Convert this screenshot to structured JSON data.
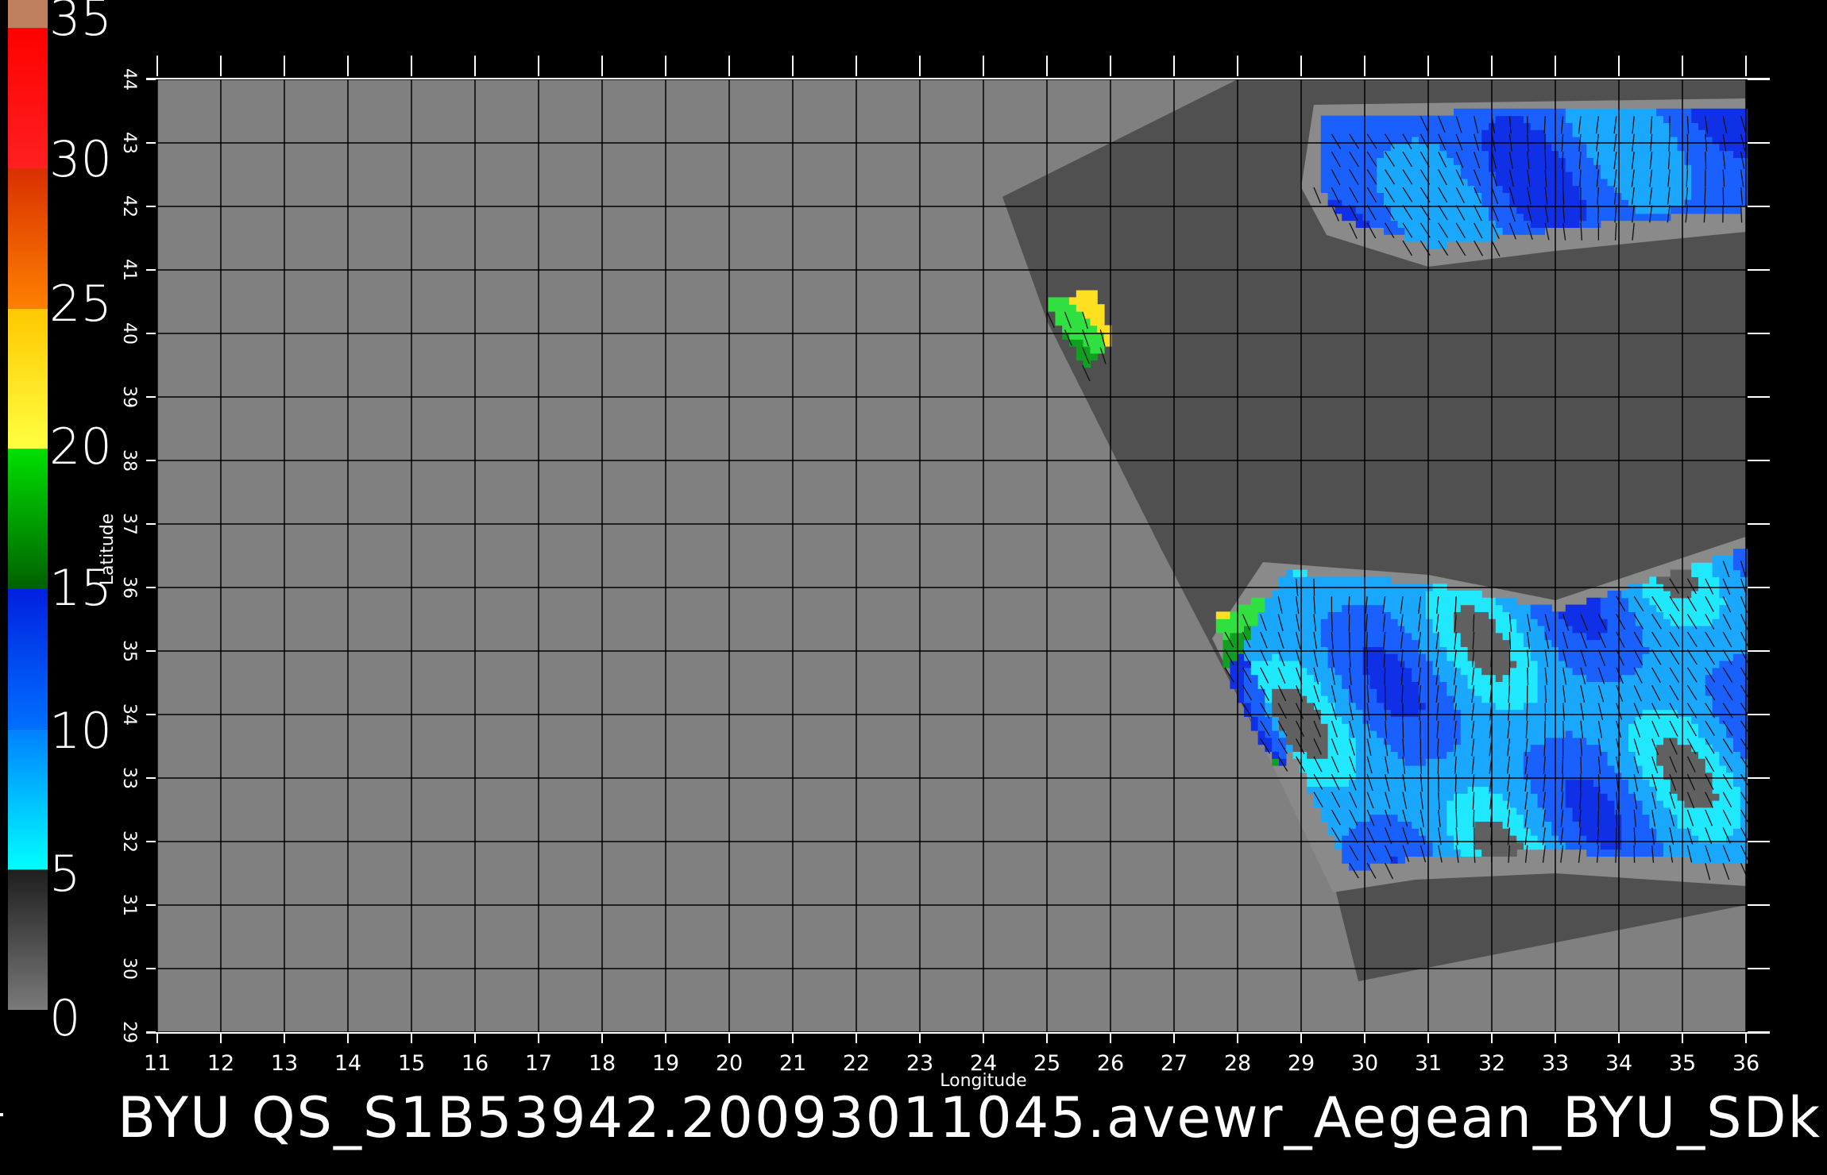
{
  "colorbar": {
    "labels": [
      "35",
      "30",
      "25",
      "20",
      "15",
      "10",
      "5",
      "0"
    ],
    "bands": [
      {
        "from": 0,
        "to": 5,
        "color": "#7a7a7a",
        "color2": "#1e1e1e"
      },
      {
        "from": 5,
        "to": 10,
        "color": "#00ffff",
        "color2": "#0080ff"
      },
      {
        "from": 10,
        "to": 15,
        "color": "#0070ff",
        "color2": "#0020e0"
      },
      {
        "from": 15,
        "to": 20,
        "color": "#006000",
        "color2": "#00e000"
      },
      {
        "from": 20,
        "to": 25,
        "color": "#ffff40",
        "color2": "#ffc800"
      },
      {
        "from": 25,
        "to": 30,
        "color": "#ff8000",
        "color2": "#d83000"
      },
      {
        "from": 30,
        "to": 35,
        "color": "#ff2020",
        "color2": "#ff0000"
      },
      {
        "from": 35,
        "to": 36,
        "color": "#c08060",
        "color2": "#c08060"
      }
    ]
  },
  "map": {
    "xlabel": "Longitude",
    "ylabel": "Latitude",
    "lon_ticks": [
      "11",
      "12",
      "13",
      "14",
      "15",
      "16",
      "17",
      "18",
      "19",
      "20",
      "21",
      "22",
      "23",
      "24",
      "25",
      "26",
      "27",
      "28",
      "29",
      "30",
      "31",
      "32",
      "33",
      "34",
      "35",
      "36"
    ],
    "lat_ticks": [
      "29",
      "30",
      "31",
      "32",
      "33",
      "34",
      "35",
      "36",
      "37",
      "38",
      "39",
      "40",
      "41",
      "42",
      "43",
      "44"
    ],
    "lon_range": [
      11,
      36
    ],
    "lat_range": [
      29,
      44
    ],
    "grid": true,
    "background_color": "#808080",
    "swath_color": "#505050",
    "land_mask_color": "#5a5a5a",
    "margin_color": "#8a8a8a"
  },
  "footer": {
    "title": "BYU  QS_S1B53942.20093011045.avewr_Aegean_BYU_SDk"
  }
}
